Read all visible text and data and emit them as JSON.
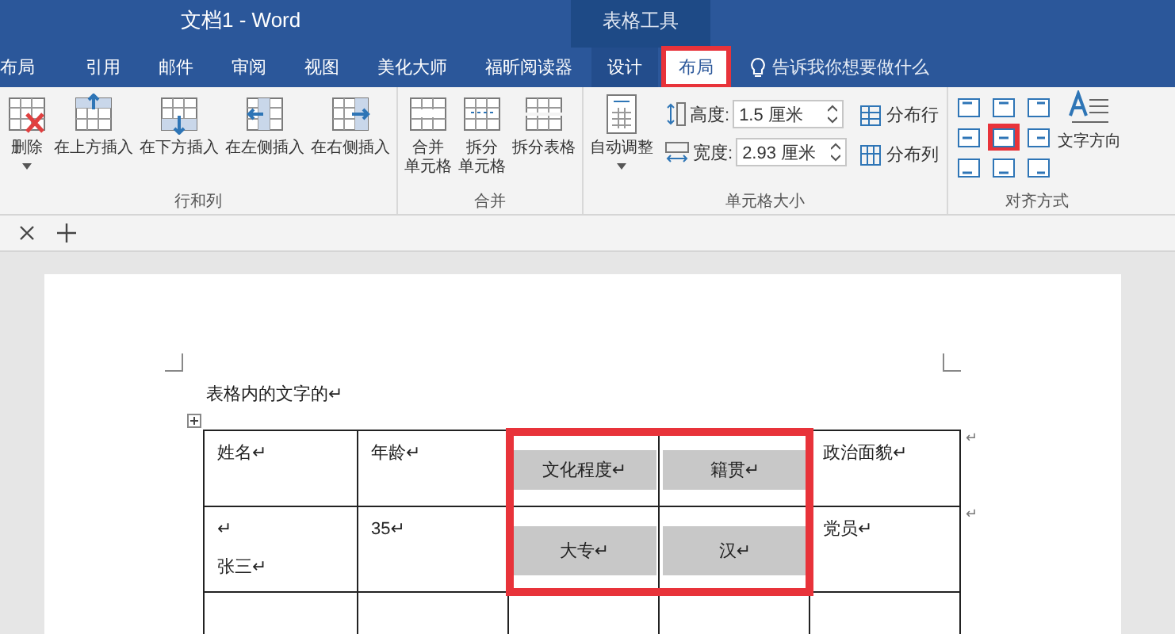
{
  "window": {
    "title": "文档1  -  Word",
    "context_title": "表格工具"
  },
  "tabs": [
    {
      "label": "布局",
      "selected": false,
      "context": false
    },
    {
      "label": "引用",
      "selected": false,
      "context": false
    },
    {
      "label": "邮件",
      "selected": false,
      "context": false
    },
    {
      "label": "审阅",
      "selected": false,
      "context": false
    },
    {
      "label": "视图",
      "selected": false,
      "context": false
    },
    {
      "label": "美化大师",
      "selected": false,
      "context": false
    },
    {
      "label": "福昕阅读器",
      "selected": false,
      "context": false
    },
    {
      "label": "设计",
      "selected": false,
      "context": true
    },
    {
      "label": "布局",
      "selected": true,
      "context": true
    }
  ],
  "tell_me": "告诉我你想要做什么",
  "groups": [
    {
      "label": "行和列",
      "buttons": [
        {
          "kind": "delete",
          "label": [
            "删除"
          ],
          "menu": true
        },
        {
          "kind": "insert-above",
          "label": [
            "在上方插入"
          ],
          "menu": false
        },
        {
          "kind": "insert-below",
          "label": [
            "在下方插入"
          ],
          "menu": false
        },
        {
          "kind": "insert-left",
          "label": [
            "在左侧插入"
          ],
          "menu": false
        },
        {
          "kind": "insert-right",
          "label": [
            "在右侧插入"
          ],
          "menu": false
        }
      ]
    },
    {
      "label": "合并",
      "buttons": [
        {
          "kind": "merge",
          "label": [
            "合并",
            "单元格"
          ],
          "menu": false
        },
        {
          "kind": "split",
          "label": [
            "拆分",
            "单元格"
          ],
          "menu": false
        },
        {
          "kind": "split-table",
          "label": [
            "拆分表格"
          ],
          "menu": false
        }
      ]
    }
  ],
  "cell_size": {
    "label": "单元格大小",
    "autofit": "自动调整",
    "height": {
      "label": "高度:",
      "value": "1.5 厘米"
    },
    "width": {
      "label": "宽度:",
      "value": "2.93 厘米"
    },
    "distribute_rows": "分布行",
    "distribute_columns": "分布列"
  },
  "alignment": {
    "label": "对齐方式",
    "cells": [
      {
        "selected": false
      },
      {
        "selected": false
      },
      {
        "selected": false
      },
      {
        "selected": false
      },
      {
        "selected": true
      },
      {
        "selected": false
      },
      {
        "selected": false
      },
      {
        "selected": false
      },
      {
        "selected": false
      }
    ],
    "text_direction": "文字方向"
  },
  "document": {
    "intro": "表格内的文字的↵",
    "table": {
      "rows": [
        {
          "row_end": "↵",
          "cells": [
            {
              "text": "姓名↵",
              "shaded": false,
              "framed": false
            },
            {
              "text": "年龄↵",
              "shaded": false,
              "framed": false
            },
            {
              "text": "文化程度↵",
              "shaded": true,
              "framed": true
            },
            {
              "text": "籍贯↵",
              "shaded": true,
              "framed": true
            },
            {
              "text": "政治面貌↵",
              "shaded": false,
              "framed": false
            }
          ]
        },
        {
          "row_end": "↵",
          "cells": [
            {
              "text": "↵\n\n张三↵",
              "shaded": false,
              "framed": false
            },
            {
              "text": "35↵",
              "shaded": false,
              "framed": false
            },
            {
              "text": "大专↵",
              "shaded": true,
              "framed": true
            },
            {
              "text": "汉↵",
              "shaded": true,
              "framed": true
            },
            {
              "text": "党员↵",
              "shaded": false,
              "framed": false
            }
          ]
        }
      ]
    }
  }
}
